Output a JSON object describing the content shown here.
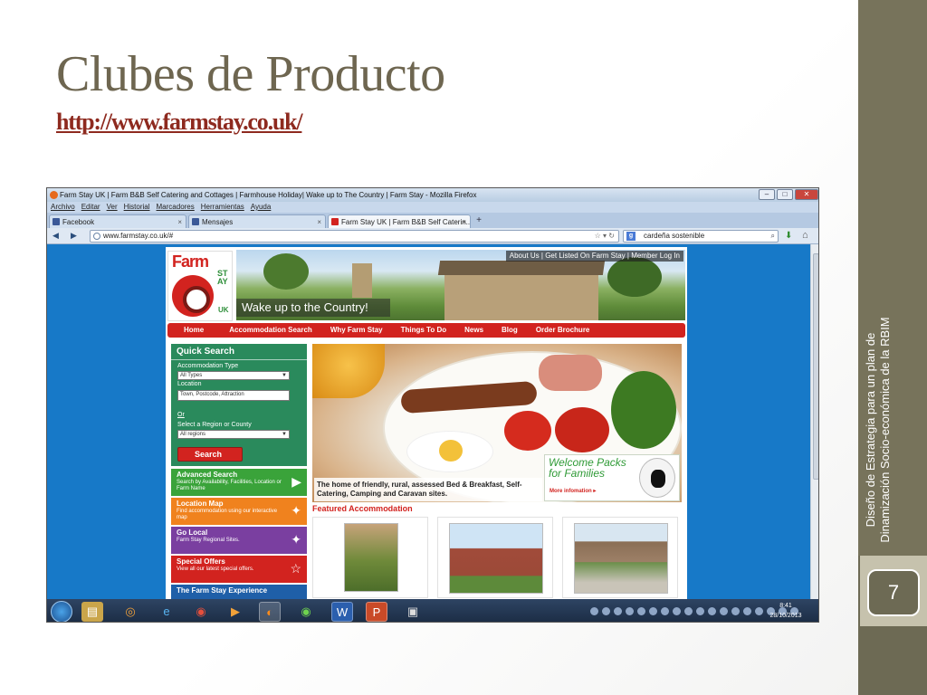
{
  "slide": {
    "title": "Clubes de Producto",
    "link": "http://www.farmstay.co.uk/",
    "side_text": "Diseño de Estrategia  para un plan de Dinamización Socio-económica de la RBIM",
    "page_number": "7"
  },
  "browser": {
    "window_title": "Farm Stay UK | Farm B&B Self Catering and Cottages | Farmhouse Holiday| Wake up to The Country | Farm Stay - Mozilla Firefox",
    "menu": [
      "Archivo",
      "Editar",
      "Ver",
      "Historial",
      "Marcadores",
      "Herramientas",
      "Ayuda"
    ],
    "tabs": [
      {
        "label": "Facebook",
        "icon": "facebook-icon"
      },
      {
        "label": "Mensajes",
        "icon": "facebook-icon"
      },
      {
        "label": "Farm Stay UK | Farm B&B Self Caterin...",
        "icon": "farmstay-icon"
      }
    ],
    "url": "www.farmstay.co.uk/#",
    "search_value": "cardeña sostenible"
  },
  "site": {
    "logo_farm": "Farm",
    "logo_stay": "STAY",
    "logo_uk": "UK",
    "tagline": "Wake up to the Country!",
    "top_links": "About Us | Get Listed On Farm Stay | Member Log In",
    "nav": [
      "Home",
      "Accommodation Search",
      "Why Farm Stay",
      "Things To Do",
      "News",
      "Blog",
      "Order Brochure"
    ],
    "quick_search": {
      "title": "Quick Search",
      "acc_type_label": "Accommodation Type",
      "acc_type_value": "All Types",
      "location_label": "Location",
      "location_placeholder": "Town, Postcode, Attraction",
      "or": "Or",
      "region_label": "Select a Region or County",
      "region_value": "All regions",
      "search_button": "Search"
    },
    "side_boxes": [
      {
        "title": "Advanced Search",
        "sub": "Search by Availability, Facilities, Location or Farm Name",
        "color": "#3aa33a",
        "icon": "play-arrow-icon"
      },
      {
        "title": "Location Map",
        "sub": "Find accommodation using our interactive map",
        "color": "#f0821e",
        "icon": "uk-map-icon"
      },
      {
        "title": "Go Local",
        "sub": "Farm Stay Regional Sites.",
        "color": "#7a3fa0",
        "icon": "uk-map-icon"
      },
      {
        "title": "Special Offers",
        "sub": "View all our latest special offers.",
        "color": "#d2231f",
        "icon": "star-icon"
      },
      {
        "title": "The Farm Stay Experience",
        "sub": "",
        "color": "#1f5fa8",
        "icon": ""
      }
    ],
    "hero_caption": "The home of friendly, rural, assessed Bed & Breakfast, Self-Catering, Camping and Caravan sites.",
    "packs_title": "Welcome Packs for Families",
    "packs_more": "More infomation ▸",
    "featured_title": "Featured Accommodation"
  },
  "taskbar": {
    "time": "8:41",
    "date": "28/10/2013"
  }
}
